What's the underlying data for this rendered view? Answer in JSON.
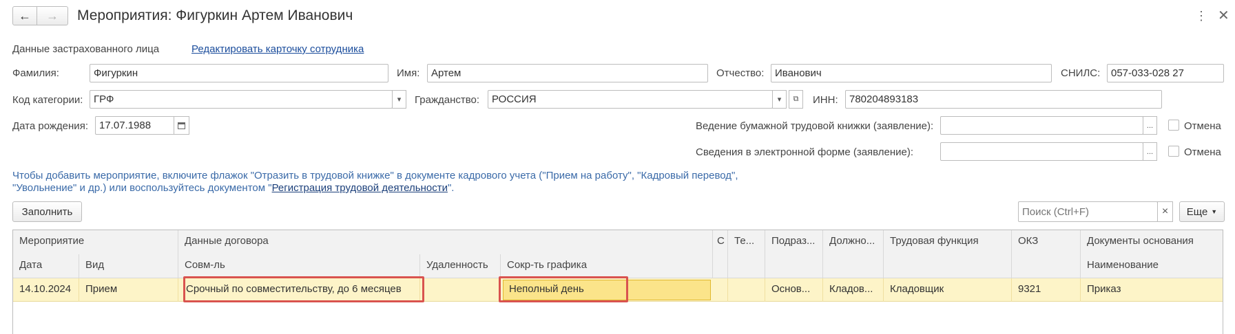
{
  "window": {
    "title": "Мероприятия: Фигуркин Артем Иванович"
  },
  "insured": {
    "section_label": "Данные застрахованного лица",
    "edit_link": "Редактировать карточку сотрудника",
    "last_name_label": "Фамилия:",
    "last_name": "Фигуркин",
    "first_name_label": "Имя:",
    "first_name": "Артем",
    "middle_name_label": "Отчество:",
    "middle_name": "Иванович",
    "snils_label": "СНИЛС:",
    "snils": "057-033-028 27",
    "category_label": "Код категории:",
    "category": "ГРФ",
    "citizenship_label": "Гражданство:",
    "citizenship": "РОССИЯ",
    "inn_label": "ИНН:",
    "inn": "780204893183",
    "birth_label": "Дата рождения:",
    "birth_date": "17.07.1988",
    "paper_book_label": "Ведение бумажной трудовой книжки (заявление):",
    "paper_book_value": "",
    "electronic_label": "Сведения в электронной форме (заявление):",
    "electronic_value": "",
    "cancel_label": "Отмена",
    "select_button": "..."
  },
  "info": {
    "line1": "Чтобы добавить мероприятие, включите флажок \"Отразить в трудовой книжке\" в документе кадрового учета (\"Прием на работу\", \"Кадровый перевод\",",
    "line2_prefix": "\"Увольнение\" и др.) или воспользуйтесь документом \"",
    "line2_link": "Регистрация трудовой деятельности",
    "line2_suffix": "\"."
  },
  "toolbar": {
    "fill_button": "Заполнить",
    "search_placeholder": "Поиск (Ctrl+F)",
    "clear": "×",
    "more_button": "Еще"
  },
  "table": {
    "header_top": {
      "event": "Мероприятие",
      "contract": "Данные договора",
      "c": "С",
      "te": "Те...",
      "dept": "Подраз...",
      "position": "Должно...",
      "labor_function": "Трудовая функция",
      "okz": "ОКЗ",
      "documents": "Документы основания"
    },
    "header_sub": {
      "date": "Дата",
      "type": "Вид",
      "combo": "Совм-ль",
      "remote": "Удаленность",
      "schedule": "Сокр-ть графика",
      "doc_name": "Наименование"
    },
    "rows": [
      {
        "date": "14.10.2024",
        "type": "Прием",
        "combo": "Срочный по совместительству, до 6 месяцев",
        "remote": "",
        "schedule": "Неполный день",
        "dept": "Основ...",
        "position": "Кладов...",
        "labor_function": "Кладовщик",
        "okz": "9321",
        "doc_name": "Приказ"
      }
    ]
  },
  "colors": {
    "highlight": "#d9534f",
    "row_selected": "#fdf4c8",
    "active_cell": "#fbe48a"
  }
}
